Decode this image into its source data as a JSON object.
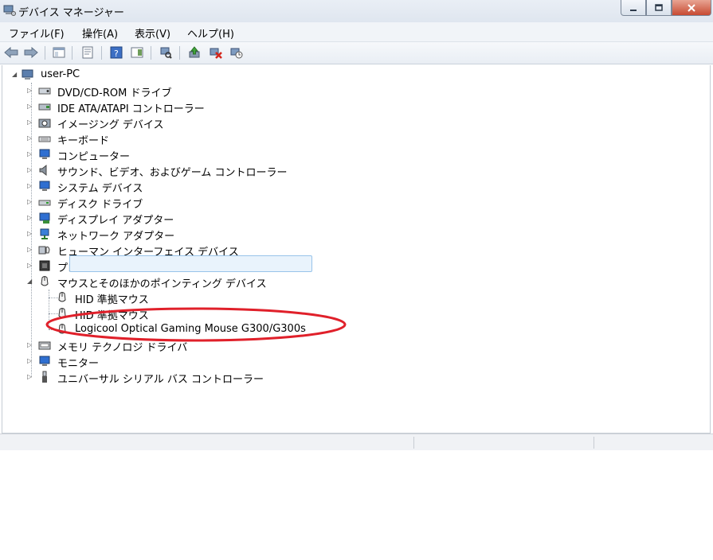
{
  "window": {
    "title": "デバイス マネージャー"
  },
  "menu": [
    "ファイル(F)",
    "操作(A)",
    "表示(V)",
    "ヘルプ(H)"
  ],
  "tree": {
    "root": "user-PC",
    "categories": [
      {
        "label": "DVD/CD-ROM ドライブ",
        "icon": "disc-drive-icon"
      },
      {
        "label": "IDE ATA/ATAPI コントローラー",
        "icon": "ide-controller-icon"
      },
      {
        "label": "イメージング デバイス",
        "icon": "camera-icon"
      },
      {
        "label": "キーボード",
        "icon": "keyboard-icon"
      },
      {
        "label": "コンピューター",
        "icon": "computer-icon"
      },
      {
        "label": "サウンド、ビデオ、およびゲーム コントローラー",
        "icon": "speaker-icon"
      },
      {
        "label": "システム デバイス",
        "icon": "system-device-icon"
      },
      {
        "label": "ディスク ドライブ",
        "icon": "disk-drive-icon"
      },
      {
        "label": "ディスプレイ アダプター",
        "icon": "display-adapter-icon"
      },
      {
        "label": "ネットワーク アダプター",
        "icon": "network-adapter-icon"
      },
      {
        "label": "ヒューマン インターフェイス デバイス",
        "icon": "hid-icon"
      },
      {
        "label": "プロセッサ",
        "icon": "processor-icon"
      },
      {
        "label": "マウスとそのほかのポインティング デバイス",
        "icon": "mouse-icon"
      },
      {
        "label": "メモリ テクノロジ ドライバ",
        "icon": "memory-icon"
      },
      {
        "label": "モニター",
        "icon": "monitor-icon"
      },
      {
        "label": "ユニバーサル シリアル バス コントローラー",
        "icon": "usb-icon"
      }
    ],
    "mouse_children": [
      "HID 準拠マウス",
      "HID 準拠マウス",
      "Logicool Optical Gaming Mouse G300/G300s"
    ]
  },
  "colors": {
    "annotation": "#e0202a",
    "selection": "#e9f3fc"
  }
}
